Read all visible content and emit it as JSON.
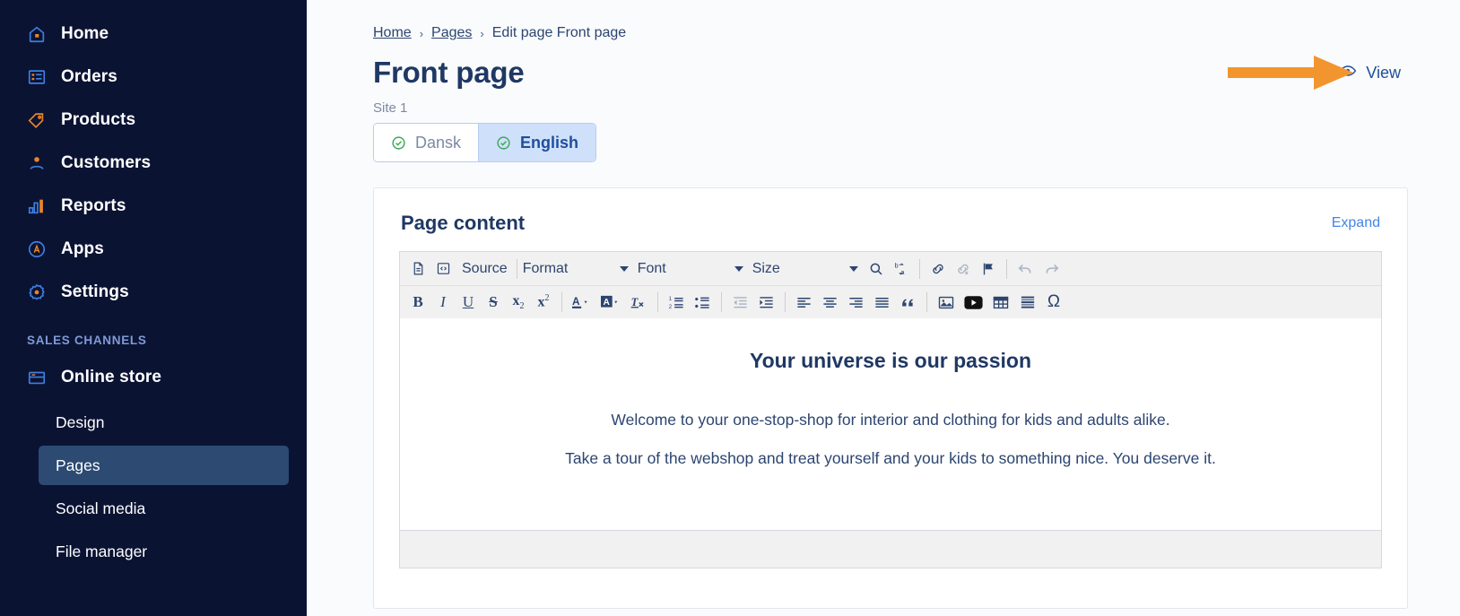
{
  "sidebar": {
    "items": [
      {
        "label": "Home",
        "icon": "home-icon"
      },
      {
        "label": "Orders",
        "icon": "orders-icon"
      },
      {
        "label": "Products",
        "icon": "tag-icon"
      },
      {
        "label": "Customers",
        "icon": "user-icon"
      },
      {
        "label": "Reports",
        "icon": "bar-chart-icon"
      },
      {
        "label": "Apps",
        "icon": "apps-icon"
      },
      {
        "label": "Settings",
        "icon": "gear-icon"
      }
    ],
    "section_title": "SALES CHANNELS",
    "channel": {
      "label": "Online store",
      "icon": "store-icon"
    },
    "sub_items": [
      {
        "label": "Design",
        "active": false
      },
      {
        "label": "Pages",
        "active": true
      },
      {
        "label": "Social media",
        "active": false
      },
      {
        "label": "File manager",
        "active": false
      }
    ],
    "colors": {
      "background": "#0b1333",
      "active": "#2c4a72",
      "accent": "#e8852a",
      "section_label": "#7f9ad6"
    }
  },
  "breadcrumb": {
    "home": "Home",
    "pages": "Pages",
    "current": "Edit page Front page",
    "separator": "›"
  },
  "header": {
    "title": "Front page",
    "view_label": "View",
    "view_icon": "eye-icon",
    "site_label": "Site 1"
  },
  "language_tabs": [
    {
      "label": "Dansk",
      "active": false,
      "icon": "check-circle-icon"
    },
    {
      "label": "English",
      "active": true,
      "icon": "check-circle-icon"
    }
  ],
  "card": {
    "title": "Page content",
    "expand_label": "Expand"
  },
  "editor": {
    "toolbar_row1": [
      {
        "name": "templates-icon",
        "type": "icon",
        "disabled": false
      },
      {
        "name": "source-icon",
        "type": "icon",
        "disabled": false
      },
      {
        "name": "source-button",
        "type": "text",
        "label": "Source",
        "disabled": false
      },
      {
        "name": "format-dropdown",
        "type": "combo",
        "label": "Format",
        "disabled": false
      },
      {
        "name": "font-dropdown",
        "type": "combo",
        "label": "Font",
        "disabled": false
      },
      {
        "name": "size-dropdown",
        "type": "combo",
        "label": "Size",
        "disabled": false
      },
      {
        "name": "find-icon",
        "type": "icon",
        "disabled": false
      },
      {
        "name": "replace-icon",
        "type": "icon",
        "disabled": false
      },
      {
        "name": "link-icon",
        "type": "icon",
        "disabled": false
      },
      {
        "name": "unlink-icon",
        "type": "icon",
        "disabled": true
      },
      {
        "name": "anchor-flag-icon",
        "type": "icon",
        "disabled": false
      },
      {
        "name": "undo-icon",
        "type": "icon",
        "disabled": true
      },
      {
        "name": "redo-icon",
        "type": "icon",
        "disabled": true
      }
    ],
    "toolbar_row2": [
      {
        "name": "bold-button",
        "label": "B",
        "disabled": false
      },
      {
        "name": "italic-button",
        "label": "I",
        "disabled": false
      },
      {
        "name": "underline-button",
        "label": "U",
        "disabled": false
      },
      {
        "name": "strikethrough-button",
        "label": "S",
        "disabled": false
      },
      {
        "name": "subscript-button",
        "label": "x",
        "sub": "2",
        "disabled": false
      },
      {
        "name": "superscript-button",
        "label": "x",
        "sup": "2",
        "disabled": false
      },
      {
        "name": "text-color-icon",
        "disabled": false
      },
      {
        "name": "background-color-icon",
        "disabled": false
      },
      {
        "name": "remove-format-icon",
        "disabled": false
      },
      {
        "name": "numbered-list-icon",
        "disabled": false
      },
      {
        "name": "bulleted-list-icon",
        "disabled": false
      },
      {
        "name": "outdent-icon",
        "disabled": true
      },
      {
        "name": "indent-icon",
        "disabled": false
      },
      {
        "name": "align-left-icon",
        "disabled": false
      },
      {
        "name": "align-center-icon",
        "disabled": false
      },
      {
        "name": "align-right-icon",
        "disabled": false
      },
      {
        "name": "justify-icon",
        "disabled": false
      },
      {
        "name": "blockquote-icon",
        "disabled": false
      },
      {
        "name": "image-icon",
        "disabled": false
      },
      {
        "name": "youtube-icon",
        "disabled": false
      },
      {
        "name": "table-icon",
        "disabled": false
      },
      {
        "name": "horizontal-rule-icon",
        "disabled": false
      },
      {
        "name": "special-character-icon",
        "label": "Ω",
        "disabled": false
      }
    ],
    "content": {
      "heading": "Your universe is our passion",
      "paragraph1": "Welcome to your one-stop-shop for interior and clothing for kids and adults alike.",
      "paragraph2": "Take a tour of the webshop and treat yourself and your kids to something nice. You deserve it."
    }
  },
  "annotation": {
    "type": "arrow",
    "color": "#f2952e",
    "points_at": "view-button"
  }
}
